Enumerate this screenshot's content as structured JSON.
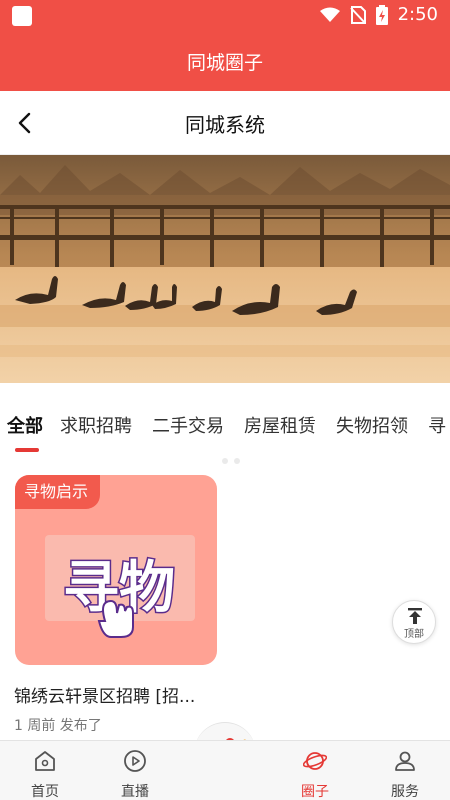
{
  "status_bar": {
    "time": "2:50"
  },
  "app_header": {
    "title": "同城圈子"
  },
  "sub_header": {
    "title": "同城系统"
  },
  "tabs": [
    {
      "label": "全部",
      "active": true
    },
    {
      "label": "求职招聘",
      "active": false
    },
    {
      "label": "二手交易",
      "active": false
    },
    {
      "label": "房屋租赁",
      "active": false
    },
    {
      "label": "失物招领",
      "active": false
    },
    {
      "label": "寻",
      "active": false
    }
  ],
  "post": {
    "tag": "寻物启示",
    "image_text": "寻物",
    "title": "锦绣云轩景区招聘 [招...",
    "meta": "1 周前 发布了"
  },
  "back_to_top": {
    "label": "顶部"
  },
  "bottom_nav": [
    {
      "label": "首页",
      "icon": "home-icon"
    },
    {
      "label": "直播",
      "icon": "play-icon"
    },
    {
      "label": "圈子",
      "icon": "planet-icon",
      "active": true
    },
    {
      "label": "服务",
      "icon": "person-icon"
    }
  ],
  "colors": {
    "primary": "#f04f46",
    "card_bg": "#ffa294",
    "tag_bg": "#f25a4d"
  }
}
